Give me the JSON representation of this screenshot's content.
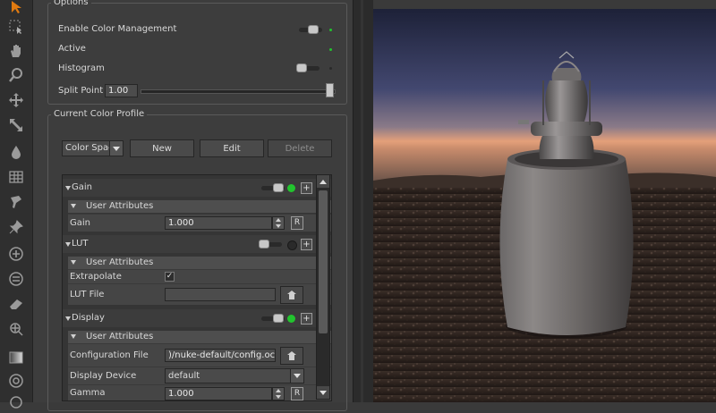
{
  "options": {
    "title": "Options",
    "enable_color_management": "Enable Color Management",
    "active": "Active",
    "histogram": "Histogram",
    "split_point_label": "Split Point",
    "split_point_value": "1.00",
    "split_point_fraction": 1.0
  },
  "profile": {
    "title": "Current Color Profile",
    "color_space_select": "Color Spac",
    "new_label": "New",
    "edit_label": "Edit",
    "delete_label": "Delete"
  },
  "sections": {
    "gain": {
      "name": "Gain",
      "user_attributes": "User Attributes",
      "gain_label": "Gain",
      "gain_value": "1.000",
      "r_label": "R"
    },
    "lut": {
      "name": "LUT",
      "user_attributes": "User Attributes",
      "extrapolate_label": "Extrapolate",
      "extrapolate_check": "✓",
      "lut_file_label": "LUT File",
      "lut_file_value": ""
    },
    "display": {
      "name": "Display",
      "user_attributes": "User Attributes",
      "config_label": "Configuration File",
      "config_value": ")/nuke-default/config.ocio",
      "device_label": "Display Device",
      "device_value": "default",
      "gamma_label": "Gamma",
      "gamma_value": "1.000",
      "r_label": "R"
    }
  },
  "plus_label": "+",
  "colors": {
    "status_on": "#22c42e",
    "status_off": "#2a2a2a",
    "accent": "#e07a10"
  },
  "icons": [
    "select-arrow-icon",
    "marquee-select-icon",
    "pan-hand-icon",
    "zoom-icon",
    "move-icon",
    "scale-icon",
    "drop-icon",
    "grid-icon",
    "paint-icon",
    "pin-icon",
    "add-circle-icon",
    "equal-circle-icon",
    "eraser-icon",
    "sparkle-icon",
    "gradient-icon",
    "target-icon",
    "bottom-icon"
  ]
}
